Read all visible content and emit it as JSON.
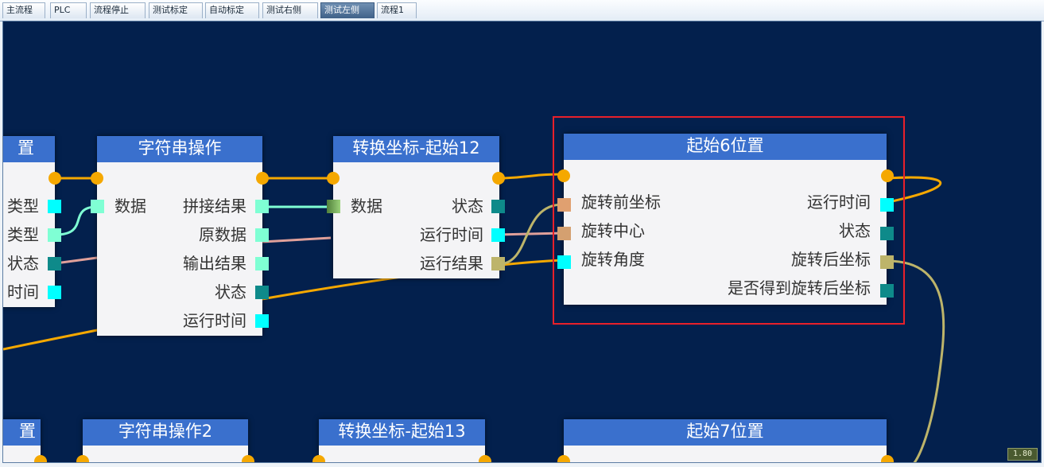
{
  "tabs": [
    {
      "label": "主流程",
      "active": false
    },
    {
      "label": "PLC",
      "active": false
    },
    {
      "label": "流程停止",
      "active": false
    },
    {
      "label": "测试标定",
      "active": false
    },
    {
      "label": "自动标定",
      "active": false
    },
    {
      "label": "测试右侧",
      "active": false
    },
    {
      "label": "测试左侧",
      "active": true
    },
    {
      "label": "流程1",
      "active": false
    }
  ],
  "nodes": {
    "partial_left": {
      "title_fragment": "置",
      "outputs": [
        "类型",
        "类型",
        "状态",
        "时间"
      ]
    },
    "string_op": {
      "title": "字符串操作",
      "inputs": [
        "数据"
      ],
      "outputs": [
        "拼接结果",
        "原数据",
        "输出结果",
        "状态",
        "运行时间"
      ]
    },
    "convert_12": {
      "title": "转换坐标-起始12",
      "inputs": [
        "数据"
      ],
      "outputs": [
        "状态",
        "运行时间",
        "运行结果"
      ]
    },
    "start_6": {
      "title": "起始6位置",
      "inputs": [
        "旋转前坐标",
        "旋转中心",
        "旋转角度"
      ],
      "outputs": [
        "运行时间",
        "状态",
        "旋转后坐标",
        "是否得到旋转后坐标"
      ]
    },
    "bottom": {
      "partial_title": "置",
      "string_op2_title": "字符串操作2",
      "convert_13_title": "转换坐标-起始13",
      "start_7_title": "起始7位置"
    }
  },
  "colors": {
    "canvas": "#03204d",
    "node_header": "#3a70cd",
    "flow_wire": "#f5a800",
    "selection": "#e8202a",
    "port_cyan": "#00ffff",
    "port_teal": "#0e8a8a",
    "port_mint": "#7fffd4",
    "port_khaki": "#bdb46a",
    "port_salmon": "#e0a070"
  },
  "zoom": "1.80"
}
